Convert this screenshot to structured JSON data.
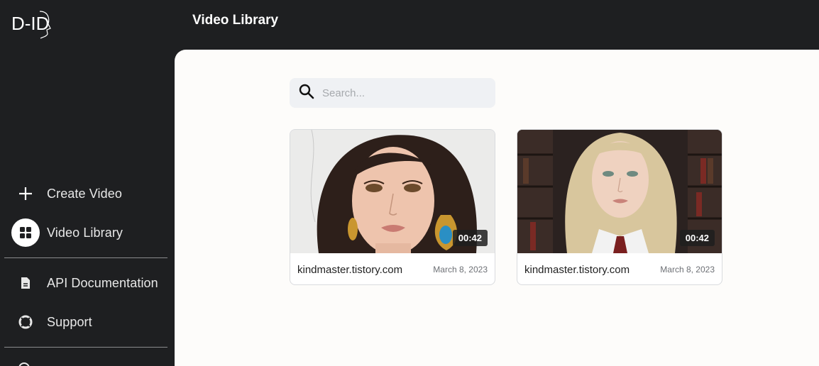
{
  "app": {
    "logo_text": "D-ID"
  },
  "header": {
    "title": "Video Library"
  },
  "sidebar": {
    "items": [
      {
        "label": "Create Video",
        "icon": "plus-icon"
      },
      {
        "label": "Video Library",
        "icon": "grid-icon",
        "active": true
      },
      {
        "label": "API Documentation",
        "icon": "document-icon"
      },
      {
        "label": "Support",
        "icon": "lifebuoy-icon"
      }
    ]
  },
  "search": {
    "placeholder": "Search...",
    "value": ""
  },
  "videos": [
    {
      "title": "kindmaster.tistory.com",
      "date": "March 8, 2023",
      "duration": "00:42"
    },
    {
      "title": "kindmaster.tistory.com",
      "date": "March 8, 2023",
      "duration": "00:42"
    }
  ],
  "colors": {
    "sidebar_bg": "#1e1f21",
    "main_bg": "#fdfcfa",
    "search_bg": "#eff1f4",
    "active_icon_bg": "#ffffff"
  }
}
